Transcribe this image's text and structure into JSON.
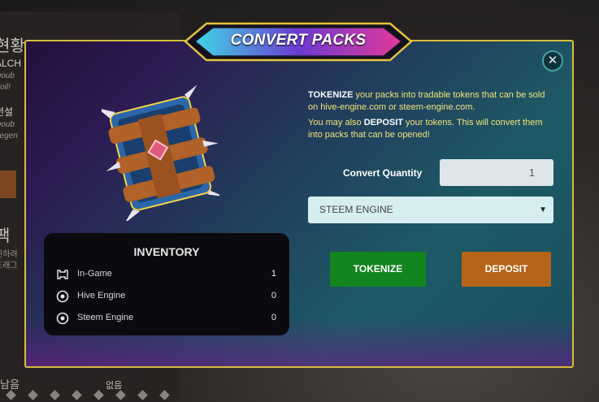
{
  "background": {
    "title": "현황",
    "lines": [
      {
        "text": "ALCH",
        "sub1": "Doub",
        "sub2": "Foil!"
      },
      {
        "text": "전설",
        "sub1": "Doub",
        "sub2": "Legen"
      }
    ],
    "section": "팩",
    "section_sub1": "인하려",
    "section_sub2": "드래그",
    "bottom_left": "남음",
    "bottom_mid": "없음"
  },
  "modal": {
    "title": "CONVERT PACKS",
    "close_icon": "close-icon",
    "desc1_strong": "TOKENIZE",
    "desc1_rest": " your packs into tradable tokens that can be sold on hive-engine.com or steem-engine.com.",
    "desc2_pre": "You may also ",
    "desc2_strong": "DEPOSIT",
    "desc2_rest": " your tokens. This will convert them into packs that can be opened!",
    "quantity_label": "Convert Quantity",
    "quantity_value": "1",
    "engine_selected": "STEEM ENGINE",
    "tokenize_button": "TOKENIZE",
    "deposit_button": "DEPOSIT",
    "colors": {
      "accent_gold": "#d7bd3a",
      "tokenize": "#13851e",
      "deposit": "#b56419"
    }
  },
  "inventory": {
    "title": "INVENTORY",
    "rows": [
      {
        "icon": "in-game-icon",
        "label": "In-Game",
        "value": "1"
      },
      {
        "icon": "hive-engine-icon",
        "label": "Hive Engine",
        "value": "0"
      },
      {
        "icon": "steem-engine-icon",
        "label": "Steem Engine",
        "value": "0"
      }
    ]
  }
}
